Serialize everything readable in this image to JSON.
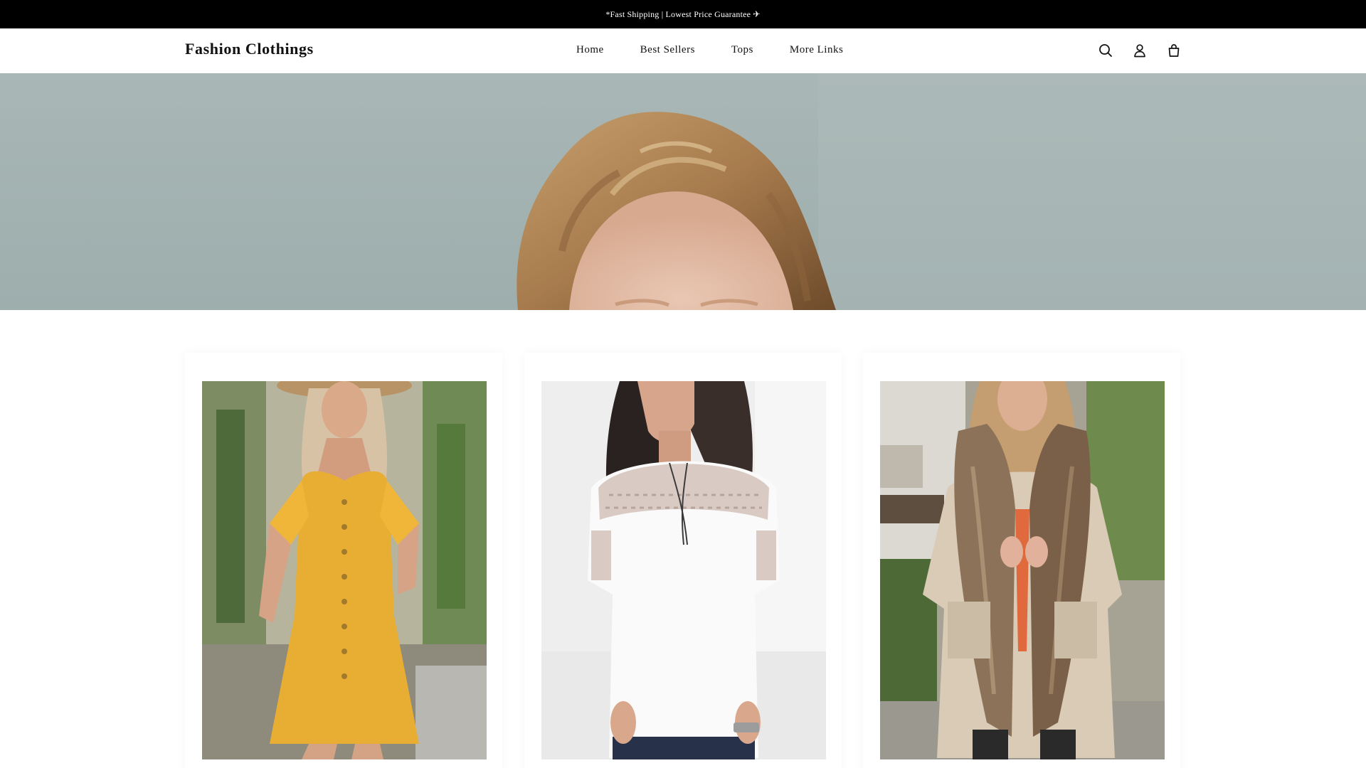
{
  "announcement": {
    "text": "*Fast Shipping | Lowest Price Guarantee ✈"
  },
  "header": {
    "logo": "Fashion Clothings",
    "nav": [
      {
        "label": "Home"
      },
      {
        "label": "Best Sellers"
      },
      {
        "label": "Tops"
      },
      {
        "label": "More Links"
      }
    ],
    "icons": [
      "search-icon",
      "account-icon",
      "cart-icon"
    ]
  },
  "hero": {
    "image": "woman-blonde-hair-forehead-hero"
  },
  "products": [
    {
      "image": "yellow-button-front-dress"
    },
    {
      "image": "white-lace-yoke-blouse"
    },
    {
      "image": "beige-parka-fur-hood"
    }
  ],
  "colors": {
    "announcement_bg": "#000000",
    "announcement_text": "#ffffff",
    "page_bg": "#ffffff",
    "hero_bg": "#a7b5b4",
    "text": "#111111"
  }
}
